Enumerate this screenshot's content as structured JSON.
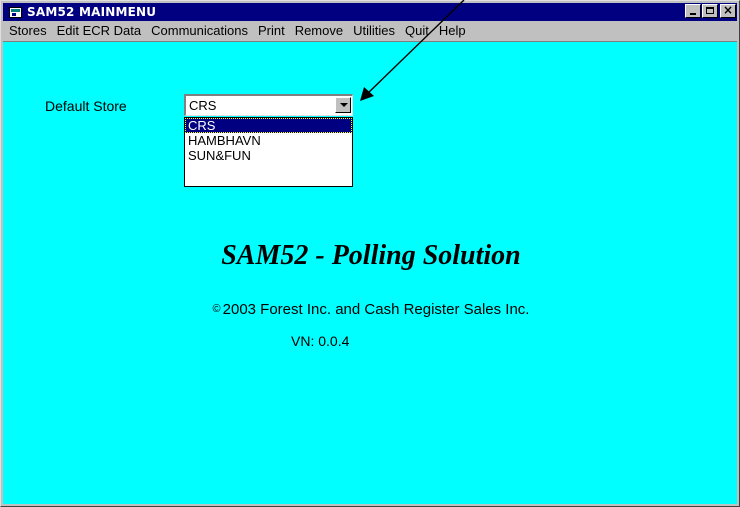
{
  "window": {
    "title": "SAM52 MAINMENU",
    "colors": {
      "titlebar": "#000080",
      "client_bg": "#00ffff",
      "chrome": "#c0c0c0"
    }
  },
  "caption_buttons": {
    "minimize_icon": "minimize-icon",
    "maximize_icon": "maximize-icon",
    "close_icon": "close-icon",
    "close_glyph": "×"
  },
  "menu": {
    "items": [
      "Stores",
      "Edit ECR Data",
      "Communications",
      "Print",
      "Remove",
      "Utilities",
      "Quit",
      "Help"
    ]
  },
  "store": {
    "label": "Default Store",
    "selected": "CRS",
    "options": [
      "CRS",
      "HAMBHAVN",
      "SUN&FUN"
    ],
    "highlighted_index": 0
  },
  "main": {
    "heading": "SAM52 - Polling Solution",
    "copyright_symbol": "©",
    "copyright": "2003 Forest Inc. and Cash Register Sales Inc.",
    "version": "VN: 0.0.4"
  }
}
